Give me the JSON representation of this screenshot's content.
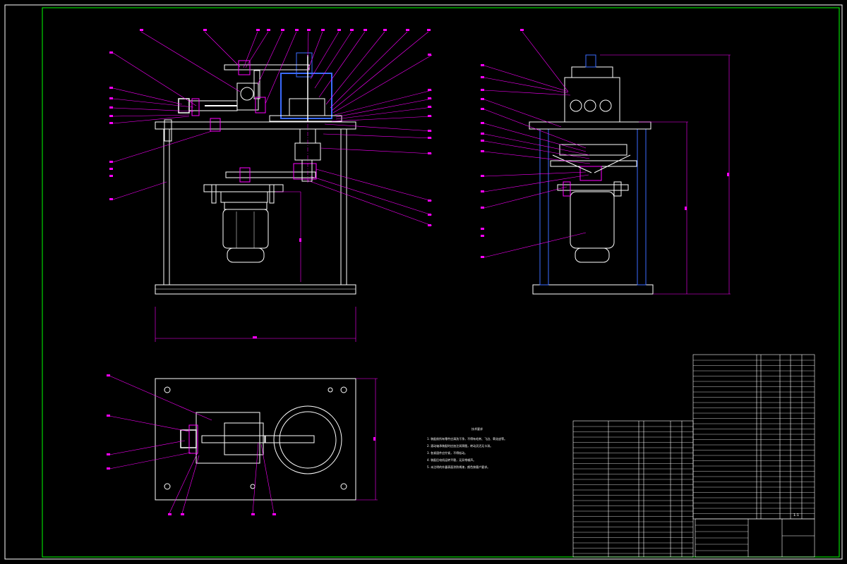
{
  "drawing": {
    "notes_title": "技术要求",
    "notes": [
      "1. 装配前所有零件应清洗干净，不得有毛刺、飞边、氧化皮等。",
      "2. 滚动轴承装配时应加注润滑脂，转动灵活无卡滞。",
      "3. 各紧固件应拧紧，不得松动。",
      "4. 装配后电机运转平稳，无异常噪声。",
      "5. 未注明的外露表面涂防锈漆，颜色按客户要求。"
    ],
    "title_block": {
      "drawing_name": "",
      "scale": "1:1"
    },
    "colors": {
      "background": "#000000",
      "frame": "#00ff00",
      "geometry": "#ffffff",
      "annotation": "#ff00ff",
      "hidden": "#0000ff"
    }
  }
}
